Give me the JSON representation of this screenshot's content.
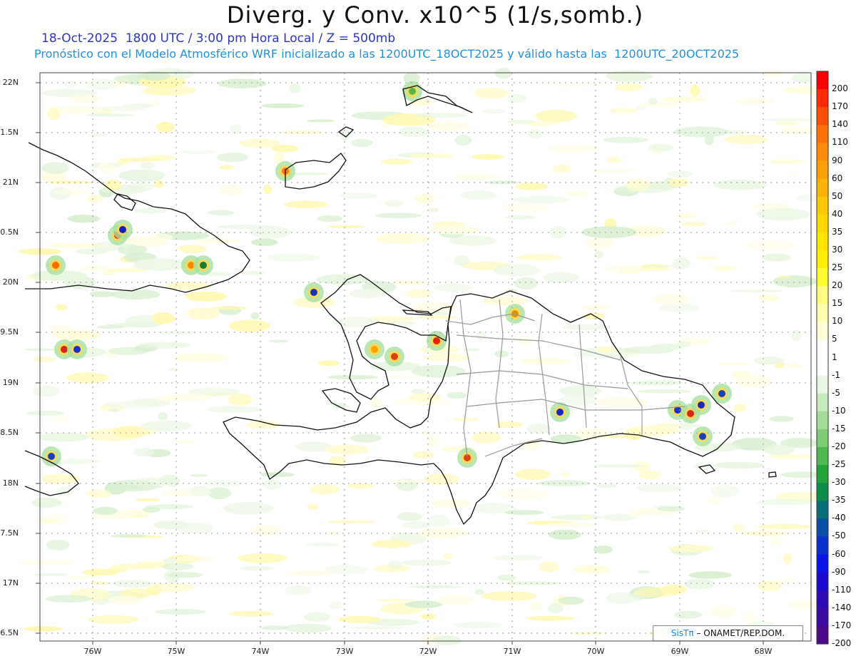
{
  "title": "Diverg. y Conv. x10^5 (1/s,somb.)",
  "subtitle_time": "18-Oct-2025  1800 UTC / 3:00 pm Hora Local / Z = 500mb",
  "subtitle_model": "Pronóstico con el Modelo Atmosférico WRF inicializado a las 1200UTC_18OCT2025 y válido hasta las  1200UTC_20OCT2025",
  "lat_labels": [
    "22N",
    "1.5N",
    "21N",
    "0.5N",
    "20N",
    "9.5N",
    "19N",
    "8.5N",
    "18N",
    "7.5N",
    "17N",
    "6.5N"
  ],
  "lon_labels": [
    "76W",
    "75W",
    "74W",
    "73W",
    "72W",
    "71W",
    "70W",
    "69W",
    "68W"
  ],
  "colorbar": {
    "labels": [
      "200",
      "170",
      "140",
      "110",
      "90",
      "60",
      "50",
      "40",
      "35",
      "30",
      "25",
      "20",
      "15",
      "10",
      "5",
      "1",
      "-1",
      "-5",
      "-10",
      "-15",
      "-20",
      "-25",
      "-30",
      "-35",
      "-40",
      "-50",
      "-60",
      "-90",
      "-110",
      "-140",
      "-170",
      "-200"
    ],
    "colors": [
      "#ff0000",
      "#ff2a00",
      "#ff5000",
      "#ff7000",
      "#ff8c00",
      "#ffa000",
      "#ffb400",
      "#ffc800",
      "#ffd800",
      "#ffe600",
      "#fff000",
      "#ffff30",
      "#ffff80",
      "#ffffb0",
      "#ffffd8",
      "#ffffff",
      "#ffffff",
      "#eaf7e6",
      "#c8ecc0",
      "#a4dc98",
      "#7dcc74",
      "#50b850",
      "#22a43a",
      "#0d8c4a",
      "#0a6e78",
      "#0b4ea8",
      "#0a2fd0",
      "#0a12e8",
      "#1a0ad0",
      "#2c0ab8",
      "#3c0aa0",
      "#4c0a88"
    ]
  },
  "credit": {
    "sis": "SisT",
    "pi": "π",
    "rest": "– ONAMET/REP.DOM."
  }
}
